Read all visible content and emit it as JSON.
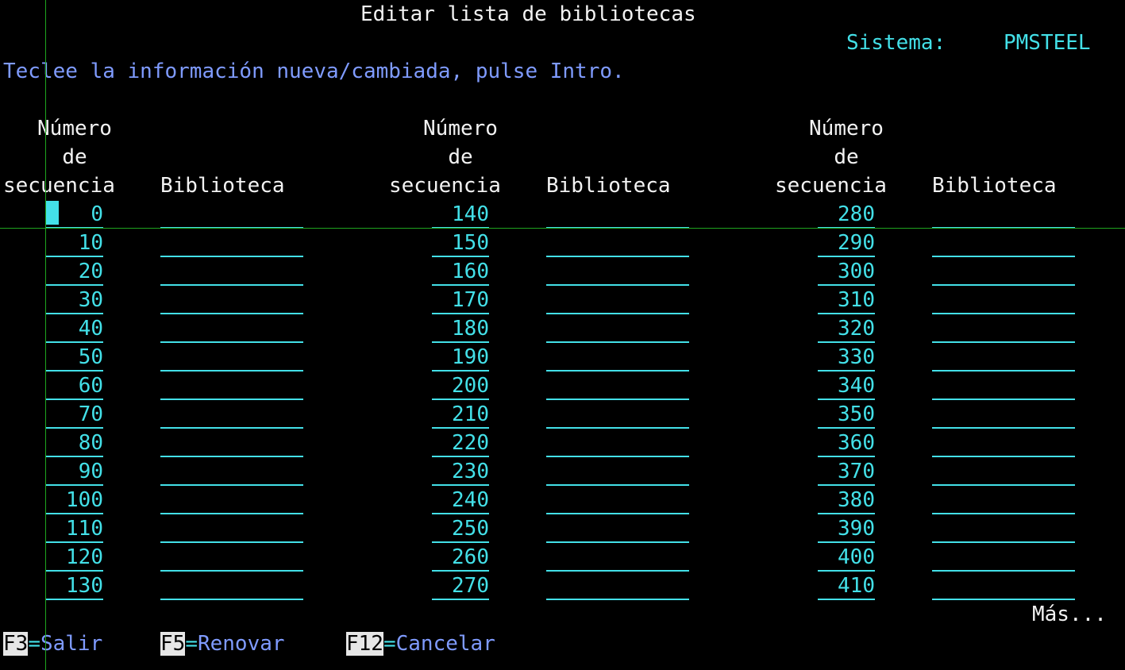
{
  "title": "Editar lista de bibliotecas",
  "system": {
    "label": "Sistema:",
    "value": "PMSTEEL"
  },
  "instruction": "Teclee la información nueva/cambiada, pulse Intro.",
  "headers": {
    "seq_line1": "Número",
    "seq_line2": "de",
    "seq_line3": "secuencia",
    "library": "Biblioteca"
  },
  "columns": [
    {
      "sequence_numbers": [
        "0",
        "10",
        "20",
        "30",
        "40",
        "50",
        "60",
        "70",
        "80",
        "90",
        "100",
        "110",
        "120",
        "130"
      ]
    },
    {
      "sequence_numbers": [
        "140",
        "150",
        "160",
        "170",
        "180",
        "190",
        "200",
        "210",
        "220",
        "230",
        "240",
        "250",
        "260",
        "270"
      ]
    },
    {
      "sequence_numbers": [
        "280",
        "290",
        "300",
        "310",
        "320",
        "330",
        "340",
        "350",
        "360",
        "370",
        "380",
        "390",
        "400",
        "410"
      ]
    }
  ],
  "more_indicator": "Más...",
  "function_keys": [
    {
      "key": "F3",
      "label": "Salir"
    },
    {
      "key": "F5",
      "label": "Renovar"
    },
    {
      "key": "F12",
      "label": "Cancelar"
    }
  ],
  "colors": {
    "background": "#000000",
    "field": "#43e0e8",
    "instruction": "#7f9bff",
    "heading": "#f2f2f2",
    "crosshair": "#1fa51f"
  }
}
